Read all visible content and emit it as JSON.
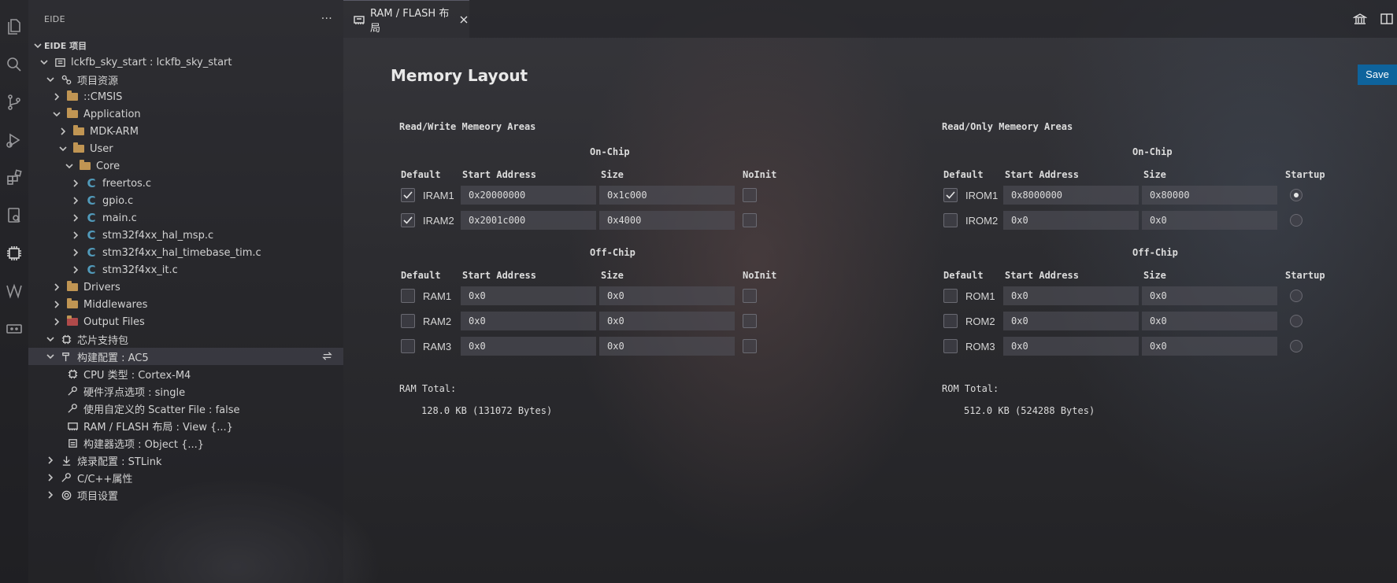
{
  "sidebar": {
    "title": "EIDE",
    "section": "EIDE 项目",
    "tree": [
      {
        "label": "lckfb_sky_start : lckfb_sky_start",
        "depth": 1,
        "chevron": "down",
        "icon": "project-icon"
      },
      {
        "label": "项目资源",
        "depth": 2,
        "chevron": "down",
        "icon": "resources-icon"
      },
      {
        "label": "::CMSIS",
        "depth": 3,
        "chevron": "right",
        "icon": "folder-icon"
      },
      {
        "label": "Application",
        "depth": 3,
        "chevron": "down",
        "icon": "folder-icon"
      },
      {
        "label": "MDK-ARM",
        "depth": 4,
        "chevron": "right",
        "icon": "folder-icon"
      },
      {
        "label": "User",
        "depth": 4,
        "chevron": "down",
        "icon": "folder-icon"
      },
      {
        "label": "Core",
        "depth": 5,
        "chevron": "down",
        "icon": "folder-icon"
      },
      {
        "label": "freertos.c",
        "depth": 6,
        "chevron": "right",
        "icon": "c-file-icon"
      },
      {
        "label": "gpio.c",
        "depth": 6,
        "chevron": "right",
        "icon": "c-file-icon"
      },
      {
        "label": "main.c",
        "depth": 6,
        "chevron": "right",
        "icon": "c-file-icon"
      },
      {
        "label": "stm32f4xx_hal_msp.c",
        "depth": 6,
        "chevron": "right",
        "icon": "c-file-icon"
      },
      {
        "label": "stm32f4xx_hal_timebase_tim.c",
        "depth": 6,
        "chevron": "right",
        "icon": "c-file-icon"
      },
      {
        "label": "stm32f4xx_it.c",
        "depth": 6,
        "chevron": "right",
        "icon": "c-file-icon"
      },
      {
        "label": "Drivers",
        "depth": 3,
        "chevron": "right",
        "icon": "folder-icon"
      },
      {
        "label": "Middlewares",
        "depth": 3,
        "chevron": "right",
        "icon": "folder-icon"
      },
      {
        "label": "Output Files",
        "depth": 3,
        "chevron": "right",
        "icon": "output-folder-icon"
      },
      {
        "label": "芯片支持包",
        "depth": 2,
        "chevron": "down",
        "icon": "chip-icon"
      },
      {
        "label": "构建配置 : AC5",
        "depth": 2,
        "chevron": "down",
        "icon": "hammer-icon"
      },
      {
        "label": "CPU 类型 : Cortex-M4",
        "depth": 3,
        "chevron": "none",
        "icon": "cpu-icon"
      },
      {
        "label": "硬件浮点选项 : single",
        "depth": 3,
        "chevron": "none",
        "icon": "wrench-icon"
      },
      {
        "label": "使用自定义的 Scatter File : false",
        "depth": 3,
        "chevron": "none",
        "icon": "wrench-icon"
      },
      {
        "label": "RAM / FLASH 布局 : View {...}",
        "depth": 3,
        "chevron": "none",
        "icon": "memory-icon"
      },
      {
        "label": "构建器选项 : Object {...}",
        "depth": 3,
        "chevron": "none",
        "icon": "builder-icon"
      },
      {
        "label": "烧录配置 : STLink",
        "depth": 2,
        "chevron": "right",
        "icon": "download-icon"
      },
      {
        "label": "C/C++属性",
        "depth": 2,
        "chevron": "right",
        "icon": "wrench-icon"
      },
      {
        "label": "项目设置",
        "depth": 2,
        "chevron": "right",
        "icon": "gear-icon"
      }
    ]
  },
  "tab": {
    "label": "RAM / FLASH 布局"
  },
  "editor": {
    "title": "Memory Layout",
    "save_label": "Save",
    "rw": {
      "title": "Read/Write Memeory Areas",
      "on_chip_title": "On-Chip",
      "off_chip_title": "Off-Chip",
      "col_default": "Default",
      "col_start": "Start Address",
      "col_size": "Size",
      "col_extra": "NoInit",
      "on_chip": [
        {
          "name": "IRAM1",
          "checked": true,
          "start": "0x20000000",
          "size": "0x1c000"
        },
        {
          "name": "IRAM2",
          "checked": true,
          "start": "0x2001c000",
          "size": "0x4000"
        }
      ],
      "off_chip": [
        {
          "name": "RAM1",
          "checked": false,
          "start": "0x0",
          "size": "0x0"
        },
        {
          "name": "RAM2",
          "checked": false,
          "start": "0x0",
          "size": "0x0"
        },
        {
          "name": "RAM3",
          "checked": false,
          "start": "0x0",
          "size": "0x0"
        }
      ],
      "total_label": "RAM Total:",
      "total_value": "128.0 KB (131072 Bytes)"
    },
    "ro": {
      "title": "Read/Only Memeory Areas",
      "on_chip_title": "On-Chip",
      "off_chip_title": "Off-Chip",
      "col_default": "Default",
      "col_start": "Start Address",
      "col_size": "Size",
      "col_extra": "Startup",
      "on_chip": [
        {
          "name": "IROM1",
          "checked": true,
          "start": "0x8000000",
          "size": "0x80000",
          "startup": true
        },
        {
          "name": "IROM2",
          "checked": false,
          "start": "0x0",
          "size": "0x0",
          "startup": false
        }
      ],
      "off_chip": [
        {
          "name": "ROM1",
          "checked": false,
          "start": "0x0",
          "size": "0x0",
          "startup": false
        },
        {
          "name": "ROM2",
          "checked": false,
          "start": "0x0",
          "size": "0x0",
          "startup": false
        },
        {
          "name": "ROM3",
          "checked": false,
          "start": "0x0",
          "size": "0x0",
          "startup": false
        }
      ],
      "total_label": "ROM Total:",
      "total_value": "512.0 KB (524288 Bytes)"
    }
  },
  "colors": {
    "accent": "#0e639c",
    "folder": "#c09553",
    "c_file": "#519aba"
  }
}
